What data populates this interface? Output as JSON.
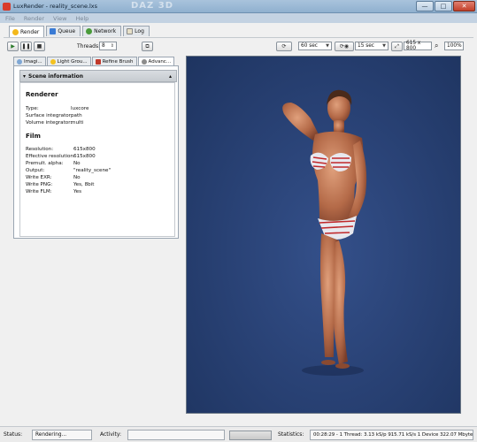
{
  "window": {
    "title": "LuxRender - reality_scene.lxs",
    "watermark": "DAZ 3D",
    "min_glyph": "—",
    "max_glyph": "□",
    "close_glyph": "✕"
  },
  "menu": [
    "File",
    "Render",
    "View",
    "Help"
  ],
  "main_tabs": [
    {
      "label": "Render",
      "icon": "render-icon",
      "active": true
    },
    {
      "label": "Queue",
      "icon": "queue-icon",
      "active": false
    },
    {
      "label": "Network",
      "icon": "network-icon",
      "active": false
    },
    {
      "label": "Log",
      "icon": "log-icon",
      "active": false
    }
  ],
  "toolbar": {
    "threads_label": "Threads:",
    "threads_value": "8",
    "refresh_value": "60 sec",
    "write_value": "15 sec",
    "resolution": "615 x 800",
    "zoom": "100%"
  },
  "sub_tabs": [
    {
      "label": "Imagi...",
      "icon": "imaging-icon",
      "active": false
    },
    {
      "label": "Light Grou...",
      "icon": "light-groups-icon",
      "active": false
    },
    {
      "label": "Refine Brush",
      "icon": "refine-brush-icon",
      "active": false
    },
    {
      "label": "Advanc...",
      "icon": "advanced-icon",
      "active": true
    }
  ],
  "scene_info": {
    "header": "Scene information",
    "renderer_heading": "Renderer",
    "renderer": [
      {
        "key": "Type:",
        "value": "luxcore"
      },
      {
        "key": "Surface integrator:",
        "value": "path"
      },
      {
        "key": "Volume integrator:",
        "value": "multi"
      }
    ],
    "film_heading": "Film",
    "film": [
      {
        "key": "Resolution:",
        "value": "615x800"
      },
      {
        "key": "Effective resolution:",
        "value": "615x800"
      },
      {
        "key": "Premult. alpha:",
        "value": "No"
      },
      {
        "key": "Output:",
        "value": "\"reality_scene\""
      },
      {
        "key": "Write EXR:",
        "value": "No"
      },
      {
        "key": "Write PNG:",
        "value": "Yes, 8bit"
      },
      {
        "key": "Write FLM:",
        "value": "Yes"
      }
    ]
  },
  "status": {
    "status_label": "Status:",
    "status_value": "Rendering...",
    "activity_label": "Activity:",
    "activity_value": "",
    "statistics_label": "Statistics:",
    "statistics_value": "00:28:29 - 1 Thread: 3.13 kS/p 915.71 kS/s 1 Device 322.07 Mbytes"
  },
  "colors": {
    "viewport_bg": "#2a4377",
    "title_bar": "#9bb7d3",
    "accent_red": "#d83b2b"
  }
}
